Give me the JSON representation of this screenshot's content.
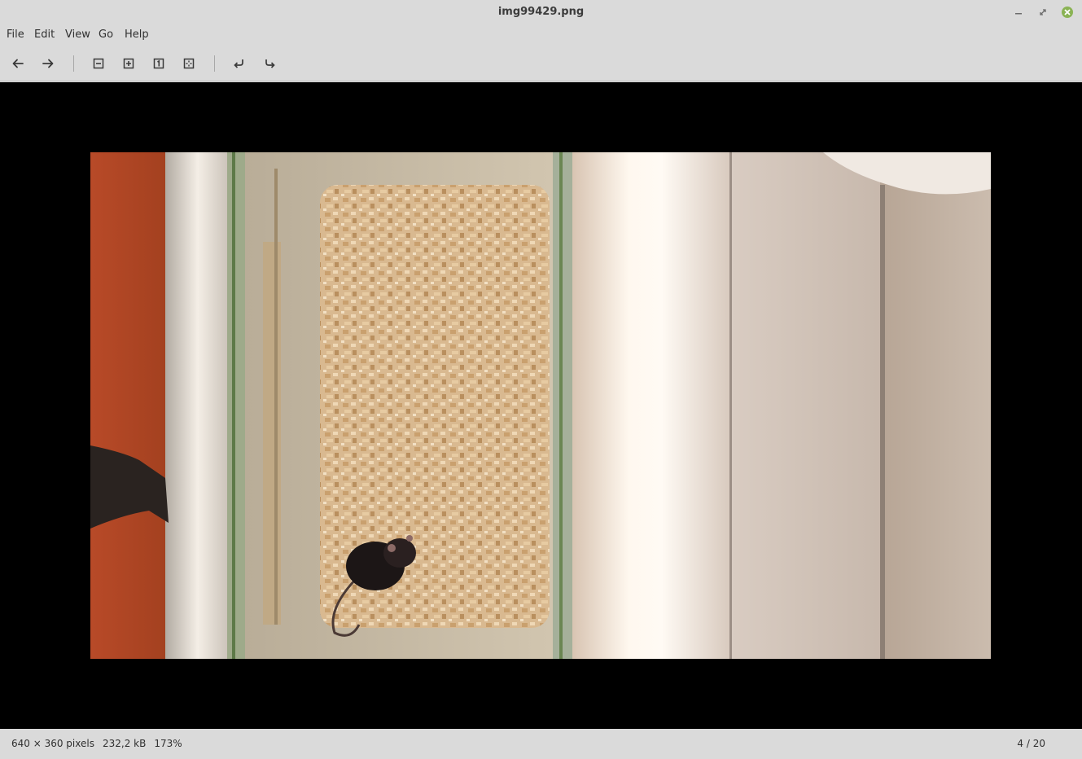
{
  "window": {
    "title": "img99429.png"
  },
  "menu": {
    "items": [
      {
        "label": "File"
      },
      {
        "label": "Edit"
      },
      {
        "label": "View"
      },
      {
        "label": "Go"
      },
      {
        "label": "Help"
      }
    ]
  },
  "toolbar": {
    "buttons": [
      {
        "name": "back-button",
        "icon": "arrow-left-icon"
      },
      {
        "name": "forward-button",
        "icon": "arrow-right-icon"
      },
      {
        "name": "zoom-out-button",
        "icon": "zoom-out-icon"
      },
      {
        "name": "zoom-in-button",
        "icon": "zoom-in-icon"
      },
      {
        "name": "zoom-100-button",
        "icon": "zoom-original-icon"
      },
      {
        "name": "zoom-fit-button",
        "icon": "zoom-fit-icon"
      },
      {
        "name": "rotate-left-button",
        "icon": "rotate-left-icon"
      },
      {
        "name": "rotate-right-button",
        "icon": "rotate-right-icon"
      }
    ]
  },
  "image": {
    "description_icon": "photo-mouse-in-cage"
  },
  "status": {
    "dimensions": "640 × 360 pixels",
    "filesize": "232,2 kB",
    "zoom": "173%",
    "position": "4 / 20"
  },
  "colors": {
    "close_button": "#8ab354",
    "chrome_bg": "#dadada",
    "viewer_bg": "#000000"
  }
}
